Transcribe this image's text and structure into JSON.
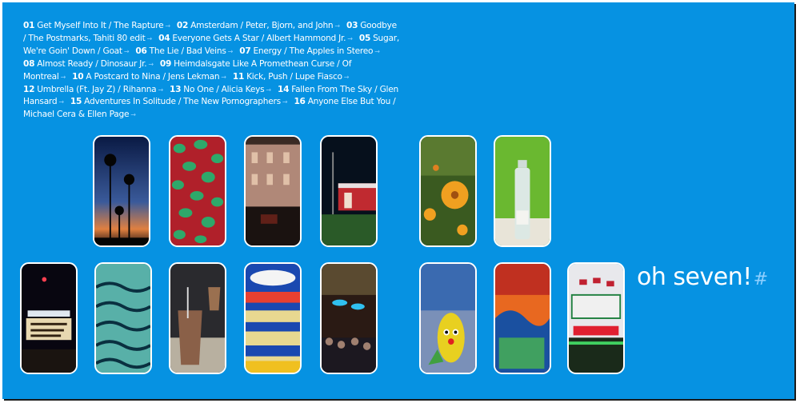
{
  "tracks": [
    {
      "num": "01",
      "text": "Get Myself Into It / The Rapture"
    },
    {
      "num": "02",
      "text": "Amsterdam / Peter, Bjorn, and John"
    },
    {
      "num": "03",
      "text": "Goodbye / The Postmarks, Tahiti 80 edit"
    },
    {
      "num": "04",
      "text": "Everyone Gets A Star / Albert Hammond Jr."
    },
    {
      "num": "05",
      "text": "Sugar, We're Goin' Down / Goat"
    },
    {
      "num": "06",
      "text": "The Lie / Bad Veins"
    },
    {
      "num": "07",
      "text": "Energy / The Apples in Stereo"
    },
    {
      "num": "08",
      "text": "Almost Ready / Dinosaur Jr."
    },
    {
      "num": "09",
      "text": "Heimdalsgate Like A Promethean Curse / Of Montreal"
    },
    {
      "num": "10",
      "text": "A Postcard to Nina / Jens Lekman"
    },
    {
      "num": "11",
      "text": "Kick, Push / Lupe Fiasco"
    },
    {
      "num": "12",
      "text": "Umbrella (Ft. Jay Z) / Rihanna"
    },
    {
      "num": "13",
      "text": "No One / Alicia Keys"
    },
    {
      "num": "14",
      "text": "Fallen From The Sky / Glen Hansard"
    },
    {
      "num": "15",
      "text": "Adventures In Solitude / The New Pornographers"
    },
    {
      "num": "16",
      "text": "Anyone Else But You / Michael Cera & Ellen Page"
    }
  ],
  "track_link_glyph": "→",
  "title": "oh seven!",
  "title_hash": "#",
  "photos_row1": [
    "palm-trees-sunset",
    "ivy-leaves",
    "street-night",
    "red-building-night",
    "orange-flowers",
    "water-bottle"
  ],
  "photos_row2": [
    "theater-marquee",
    "wave-fabric",
    "iced-coffee",
    "oreo-cakesters",
    "concert-crowd",
    "corn-toy",
    "painted-sign",
    "nathans-deli"
  ],
  "colors": {
    "background": "#0692e2",
    "text": "#ffffff",
    "link": "#8fd0ff"
  }
}
